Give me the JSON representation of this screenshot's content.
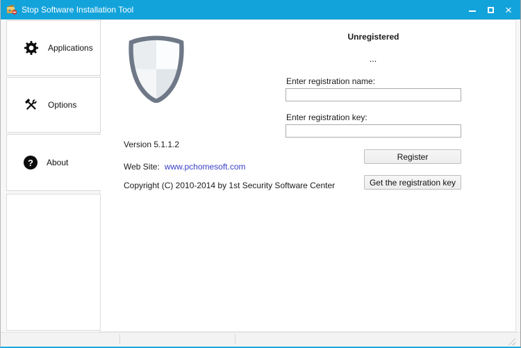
{
  "titlebar": {
    "title": "Stop Software Installation Tool",
    "close_glyph": "×"
  },
  "sidebar": {
    "items": [
      {
        "label": "Applications",
        "icon": "gear-icon"
      },
      {
        "label": "Options",
        "icon": "tools-icon"
      },
      {
        "label": "About",
        "icon": "question-icon",
        "selected": true
      }
    ]
  },
  "icons": {
    "question_glyph": "?"
  },
  "about_page": {
    "registration_status": "Unregistered",
    "status_detail": "...",
    "registration_name_label": "Enter registration name:",
    "registration_name_value": "",
    "registration_key_label": "Enter registration key:",
    "registration_key_value": "",
    "register_button": "Register",
    "get_key_button": "Get the registration key",
    "version": "Version 5.1.1.2",
    "website_label": "Web Site:",
    "website_link": "www.pchomesoft.com",
    "copyright": "Copyright (C) 2010-2014 by 1st Security Software Center"
  },
  "colors": {
    "titlebar_blue": "#13a3db",
    "link_blue": "#3a41c8",
    "shield_outline": "#6e7887"
  }
}
